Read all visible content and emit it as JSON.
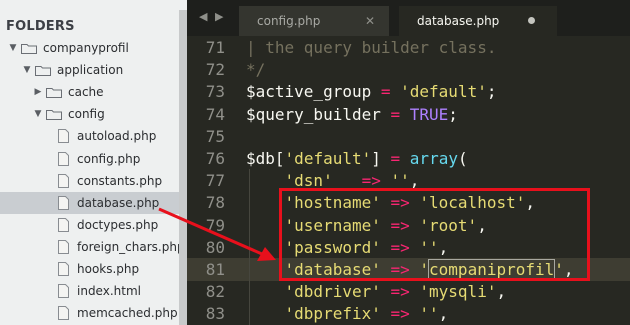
{
  "sidebar": {
    "header": "FOLDERS",
    "tree": [
      {
        "label": "companyprofil",
        "type": "folder",
        "expanded": true,
        "depth": 0
      },
      {
        "label": "application",
        "type": "folder",
        "expanded": true,
        "depth": 1
      },
      {
        "label": "cache",
        "type": "folder",
        "expanded": false,
        "depth": 2
      },
      {
        "label": "config",
        "type": "folder",
        "expanded": true,
        "depth": 2
      },
      {
        "label": "autoload.php",
        "type": "file",
        "depth": 3
      },
      {
        "label": "config.php",
        "type": "file",
        "depth": 3
      },
      {
        "label": "constants.php",
        "type": "file",
        "depth": 3
      },
      {
        "label": "database.php",
        "type": "file",
        "depth": 3,
        "selected": true
      },
      {
        "label": "doctypes.php",
        "type": "file",
        "depth": 3
      },
      {
        "label": "foreign_chars.php",
        "type": "file",
        "depth": 3
      },
      {
        "label": "hooks.php",
        "type": "file",
        "depth": 3
      },
      {
        "label": "index.html",
        "type": "file",
        "depth": 3
      },
      {
        "label": "memcached.php",
        "type": "file",
        "depth": 3
      }
    ]
  },
  "tabbar": {
    "nav_back": "◀",
    "nav_forward": "▶",
    "tabs": [
      {
        "label": "config.php",
        "close": "✕",
        "active": false
      },
      {
        "label": "database.php",
        "active": true,
        "modified": true
      }
    ]
  },
  "editor": {
    "current_line": 81,
    "lines": [
      {
        "n": "71",
        "tokens": [
          {
            "t": "| the query builder class.",
            "c": "com"
          }
        ]
      },
      {
        "n": "72",
        "tokens": [
          {
            "t": "*/",
            "c": "com"
          }
        ]
      },
      {
        "n": "73",
        "tokens": [
          {
            "t": "$active_group",
            "c": "var"
          },
          {
            "t": " = ",
            "c": "op"
          },
          {
            "t": "'default'",
            "c": "str"
          },
          {
            "t": ";",
            "c": "pun"
          }
        ]
      },
      {
        "n": "74",
        "tokens": [
          {
            "t": "$query_builder",
            "c": "var"
          },
          {
            "t": " = ",
            "c": "op"
          },
          {
            "t": "TRUE",
            "c": "con"
          },
          {
            "t": ";",
            "c": "pun"
          }
        ]
      },
      {
        "n": "75",
        "tokens": []
      },
      {
        "n": "76",
        "tokens": [
          {
            "t": "$db",
            "c": "var"
          },
          {
            "t": "[",
            "c": "pun"
          },
          {
            "t": "'default'",
            "c": "str"
          },
          {
            "t": "]",
            "c": "pun"
          },
          {
            "t": " = ",
            "c": "op"
          },
          {
            "t": "array",
            "c": "fn"
          },
          {
            "t": "(",
            "c": "pun"
          }
        ]
      },
      {
        "n": "77",
        "tokens": [
          {
            "t": "    ",
            "c": "pun"
          },
          {
            "t": "'dsn'",
            "c": "str"
          },
          {
            "t": "   ",
            "c": "pun"
          },
          {
            "t": "=>",
            "c": "op"
          },
          {
            "t": " ",
            "c": "pun"
          },
          {
            "t": "''",
            "c": "str"
          },
          {
            "t": ",",
            "c": "pun"
          }
        ]
      },
      {
        "n": "78",
        "tokens": [
          {
            "t": "    ",
            "c": "pun"
          },
          {
            "t": "'hostname'",
            "c": "str"
          },
          {
            "t": " => ",
            "c": "op"
          },
          {
            "t": "'localhost'",
            "c": "str"
          },
          {
            "t": ",",
            "c": "pun"
          }
        ]
      },
      {
        "n": "79",
        "tokens": [
          {
            "t": "    ",
            "c": "pun"
          },
          {
            "t": "'username'",
            "c": "str"
          },
          {
            "t": " => ",
            "c": "op"
          },
          {
            "t": "'root'",
            "c": "str"
          },
          {
            "t": ",",
            "c": "pun"
          }
        ]
      },
      {
        "n": "80",
        "tokens": [
          {
            "t": "    ",
            "c": "pun"
          },
          {
            "t": "'password'",
            "c": "str"
          },
          {
            "t": " => ",
            "c": "op"
          },
          {
            "t": "''",
            "c": "str"
          },
          {
            "t": ",",
            "c": "pun"
          }
        ]
      },
      {
        "n": "81",
        "tokens": [
          {
            "t": "    ",
            "c": "pun"
          },
          {
            "t": "'database'",
            "c": "str"
          },
          {
            "t": " => ",
            "c": "op"
          },
          {
            "t": "'",
            "c": "str"
          },
          {
            "t": "companiprofil",
            "c": "str",
            "hl": true
          },
          {
            "t": "'",
            "c": "str"
          },
          {
            "t": ",",
            "c": "pun"
          }
        ]
      },
      {
        "n": "82",
        "tokens": [
          {
            "t": "    ",
            "c": "pun"
          },
          {
            "t": "'dbdriver'",
            "c": "str"
          },
          {
            "t": " => ",
            "c": "op"
          },
          {
            "t": "'mysqli'",
            "c": "str"
          },
          {
            "t": ",",
            "c": "pun"
          }
        ]
      },
      {
        "n": "83",
        "tokens": [
          {
            "t": "    ",
            "c": "pun"
          },
          {
            "t": "'dbprefix'",
            "c": "str"
          },
          {
            "t": " => ",
            "c": "op"
          },
          {
            "t": "''",
            "c": "str"
          },
          {
            "t": ",",
            "c": "pun"
          }
        ]
      }
    ]
  },
  "colors": {
    "annotation": "#e8101c",
    "folder_icon": "#6b6f75",
    "file_icon": "#f4f4f2"
  }
}
